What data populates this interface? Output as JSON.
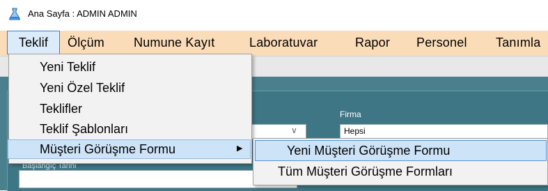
{
  "window": {
    "title": "Ana Sayfa : ADMIN ADMIN"
  },
  "menubar": {
    "items": [
      "Teklif",
      "Ölçüm",
      "Numune Kayıt",
      "Laboratuvar",
      "Rapor",
      "Personel",
      "Tanımla"
    ]
  },
  "dropdown": {
    "items": [
      "Yeni Teklif",
      "Yeni Özel Teklif",
      "Teklifler",
      "Teklif Şablonları",
      "Müşteri Görüşme Formu"
    ]
  },
  "submenu": {
    "items": [
      "Yeni Müşteri Görüşme Formu",
      "Tüm Müşteri Görüşme Formları"
    ]
  },
  "form": {
    "firma_label": "Firma",
    "firma_value": "Hepsi",
    "date_label": "Başlangıç Tarihi"
  },
  "colors": {
    "menubar": "#fbdcb8",
    "panel": "#4a7f8e",
    "highlight": "#cde3f7"
  }
}
